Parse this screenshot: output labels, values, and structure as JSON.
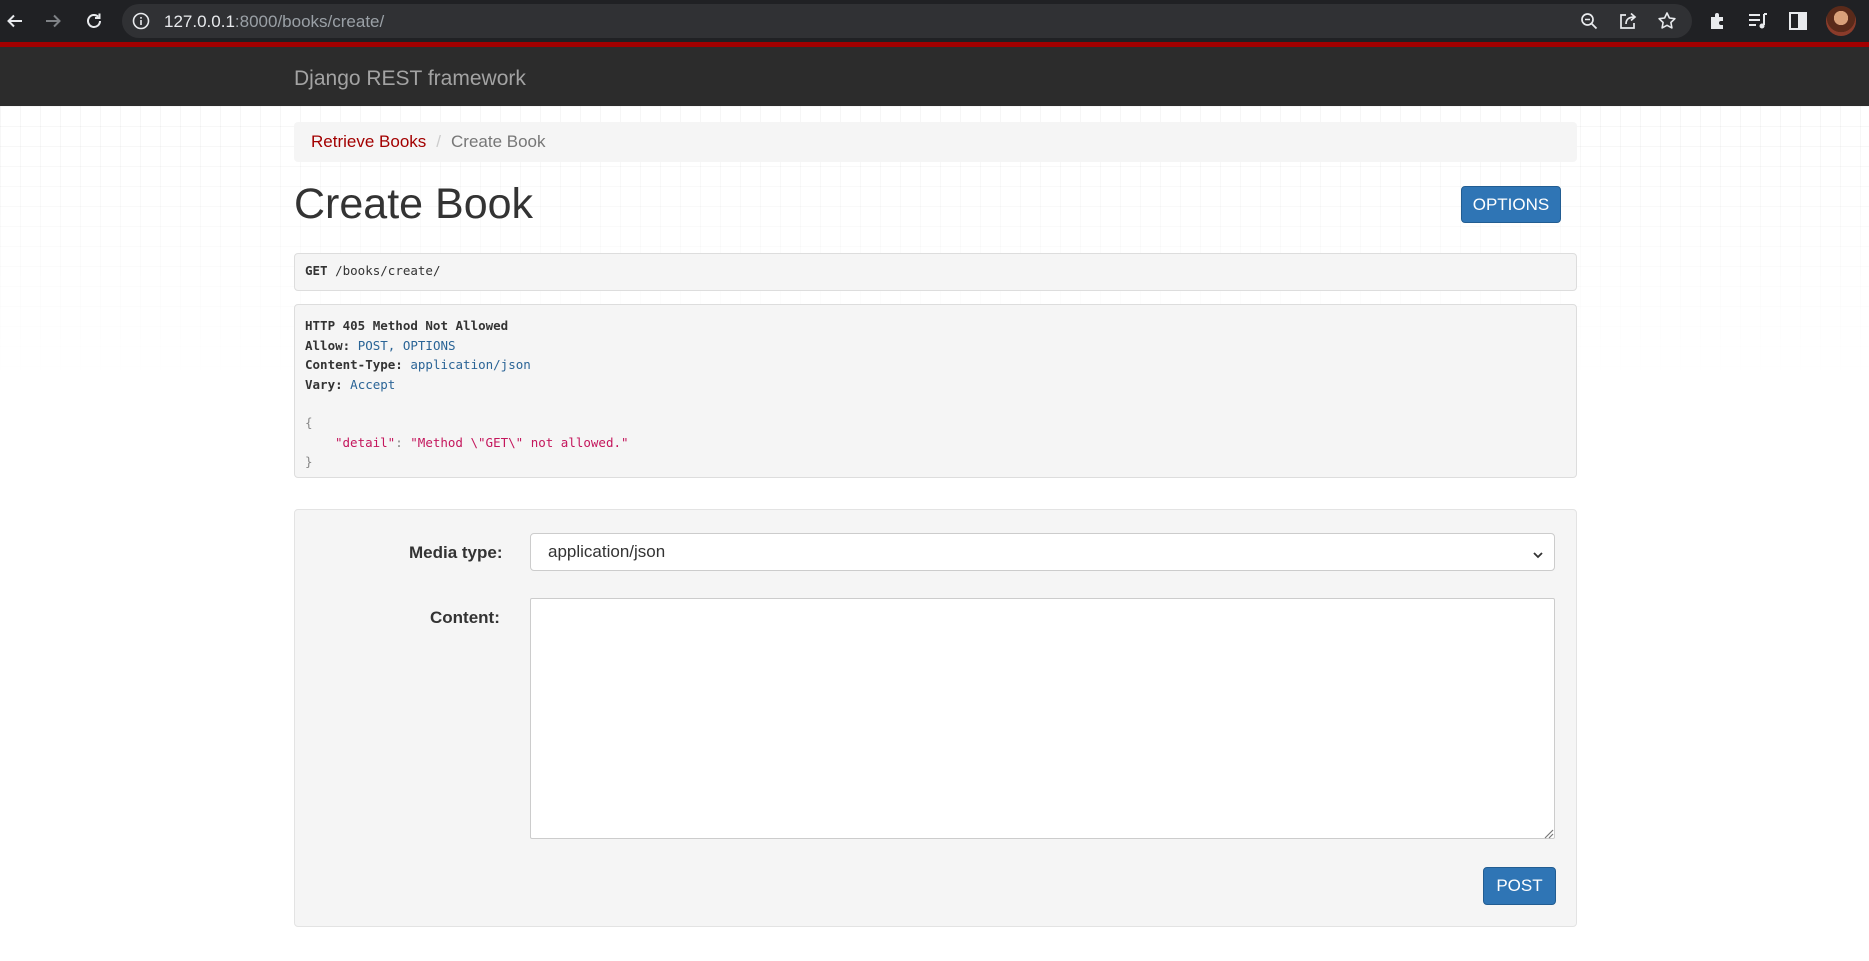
{
  "browser": {
    "url_host": "127.0.0.1",
    "url_path": ":8000/books/create/",
    "icons": [
      "back-arrow-icon",
      "forward-arrow-icon",
      "reload-icon",
      "site-info-icon",
      "zoom-icon",
      "share-icon",
      "bookmark-star-icon",
      "extensions-puzzle-icon",
      "reading-list-icon",
      "side-panel-icon",
      "profile-avatar"
    ]
  },
  "navbar": {
    "brand": "Django REST framework",
    "accent_color": "#a30000"
  },
  "breadcrumb": {
    "link": "Retrieve Books",
    "separator": "/",
    "active": "Create Book"
  },
  "page": {
    "title": "Create Book",
    "options_label": "OPTIONS"
  },
  "request": {
    "method": "GET",
    "path": "/books/create/"
  },
  "response": {
    "status": "HTTP 405 Method Not Allowed",
    "allow_key": "Allow:",
    "allow_value": "POST, OPTIONS",
    "content_type_key": "Content-Type:",
    "content_type_value": "application/json",
    "vary_key": "Vary:",
    "vary_value": "Accept",
    "open_brace": "{",
    "detail_key": "\"detail\"",
    "colon": ": ",
    "detail_value": "\"Method \\\"GET\\\" not allowed.\"",
    "close_brace": "}"
  },
  "form": {
    "media_type_label": "Media type:",
    "media_type_value": "application/json",
    "content_label": "Content:",
    "content_value": "",
    "post_label": "POST",
    "button_color": "#2f75b5"
  }
}
